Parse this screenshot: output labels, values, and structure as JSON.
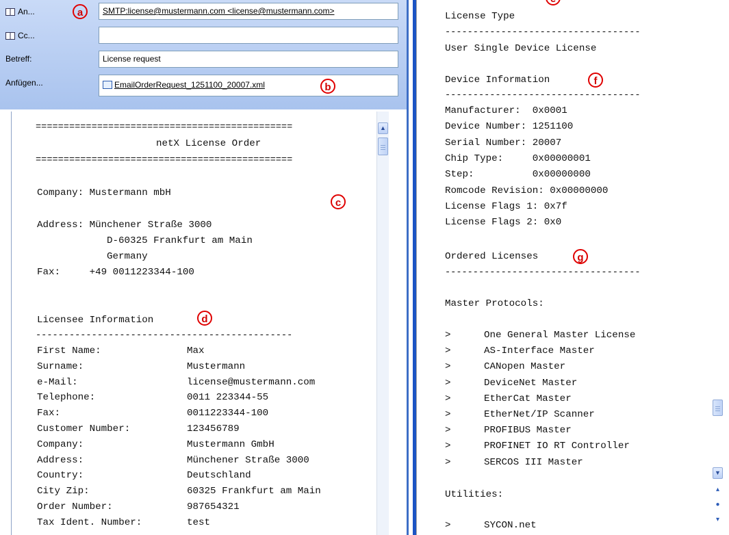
{
  "compose": {
    "to_button": "An...",
    "cc_button": "Cc...",
    "subject_label": "Betreff:",
    "attach_label": "Anfügen...",
    "to_value": "SMTP:license@mustermann.com <license@mustermann.com>",
    "cc_value": "",
    "subject_value": "License request",
    "attachment_name": "EmailOrderRequest_1251100_20007.xml"
  },
  "callouts": {
    "a": "a",
    "b": "b",
    "c": "c",
    "d": "d",
    "e": "e",
    "f": "f",
    "g": "g"
  },
  "order": {
    "rule": "==============================================",
    "title": "netX License Order",
    "company_line": "Company: Mustermann mbH",
    "address_line1": "Address: Münchener Straße 3000",
    "address_line2": "D-60325 Frankfurt am Main",
    "address_line3": "Germany",
    "fax_line": "Fax:     +49 0011223344-100",
    "licensee_heading": "Licensee Information",
    "dash_rule": "----------------------------------------------",
    "licensee": [
      {
        "label": "First Name:",
        "value": "Max"
      },
      {
        "label": "Surname:",
        "value": "Mustermann"
      },
      {
        "label": "e-Mail:",
        "value": "license@mustermann.com"
      },
      {
        "label": "Telephone:",
        "value": "0011 223344-55"
      },
      {
        "label": "Fax:",
        "value": "0011223344-100"
      },
      {
        "label": "Customer Number:",
        "value": "123456789"
      },
      {
        "label": "Company:",
        "value": "Mustermann GmbH"
      },
      {
        "label": "Address:",
        "value": "Münchener Straße 3000"
      },
      {
        "label": "Country:",
        "value": "Deutschland"
      },
      {
        "label": "City Zip:",
        "value": "60325 Frankfurt am Main"
      },
      {
        "label": "Order Number:",
        "value": "987654321"
      },
      {
        "label": "Tax Ident. Number:",
        "value": "test"
      }
    ]
  },
  "right": {
    "license_type_heading": "License Type",
    "dash_rule": "-----------------------------------",
    "license_type_value": "User Single Device License",
    "device_heading": "Device Information",
    "device": [
      "Manufacturer:  0x0001",
      "Device Number: 1251100",
      "Serial Number: 20007",
      "Chip Type:     0x00000001",
      "Step:          0x00000000",
      "Romcode Revision: 0x00000000",
      "License Flags 1: 0x7f",
      "License Flags 2: 0x0"
    ],
    "ordered_heading": "Ordered Licenses",
    "master_heading": "Master Protocols:",
    "bullet": ">",
    "masters": [
      "One General Master License",
      "AS-Interface Master",
      "CANopen Master",
      "DeviceNet Master",
      "EtherCat Master",
      "EtherNet/IP Scanner",
      "PROFIBUS Master",
      "PROFINET IO RT Controller",
      "SERCOS III Master"
    ],
    "utilities_heading": "Utilities:",
    "utilities": [
      "SYCON.net"
    ]
  }
}
